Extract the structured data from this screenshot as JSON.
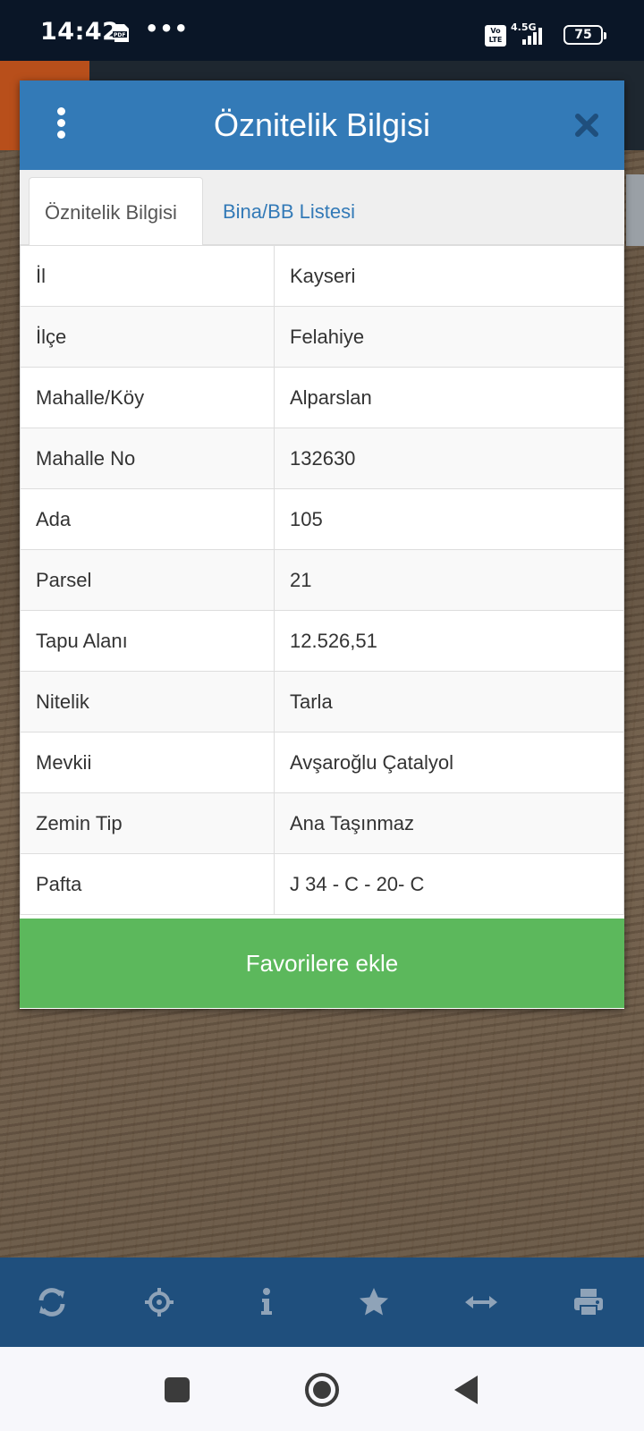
{
  "status_bar": {
    "time": "14:42",
    "more": "•••",
    "volte": "Vo LTE",
    "network": "4.5G",
    "battery": "75"
  },
  "dialog": {
    "title": "Öznitelik Bilgisi",
    "tabs": [
      {
        "label": "Öznitelik Bilgisi",
        "active": true
      },
      {
        "label": "Bina/BB Listesi",
        "active": false
      }
    ],
    "rows": [
      {
        "key": "İl",
        "value": "Kayseri"
      },
      {
        "key": "İlçe",
        "value": "Felahiye"
      },
      {
        "key": "Mahalle/Köy",
        "value": "Alparslan"
      },
      {
        "key": "Mahalle No",
        "value": "132630"
      },
      {
        "key": "Ada",
        "value": "105"
      },
      {
        "key": "Parsel",
        "value": "21"
      },
      {
        "key": "Tapu Alanı",
        "value": "12.526,51"
      },
      {
        "key": "Nitelik",
        "value": "Tarla"
      },
      {
        "key": "Mevkii",
        "value": "Avşaroğlu Çatalyol"
      },
      {
        "key": "Zemin Tip",
        "value": "Ana Taşınmaz"
      },
      {
        "key": "Pafta",
        "value": "J 34 - C - 20- C"
      }
    ],
    "favorite_button": "Favorilere ekle"
  },
  "toolbar_icons": [
    "refresh-icon",
    "crosshair-icon",
    "info-icon",
    "star-icon",
    "arrows-horizontal-icon",
    "print-icon"
  ],
  "colors": {
    "header": "#337ab7",
    "favorite": "#5cb85c",
    "toolbar": "#1f4f7d",
    "toolbar_icon": "#8fa3b8"
  }
}
